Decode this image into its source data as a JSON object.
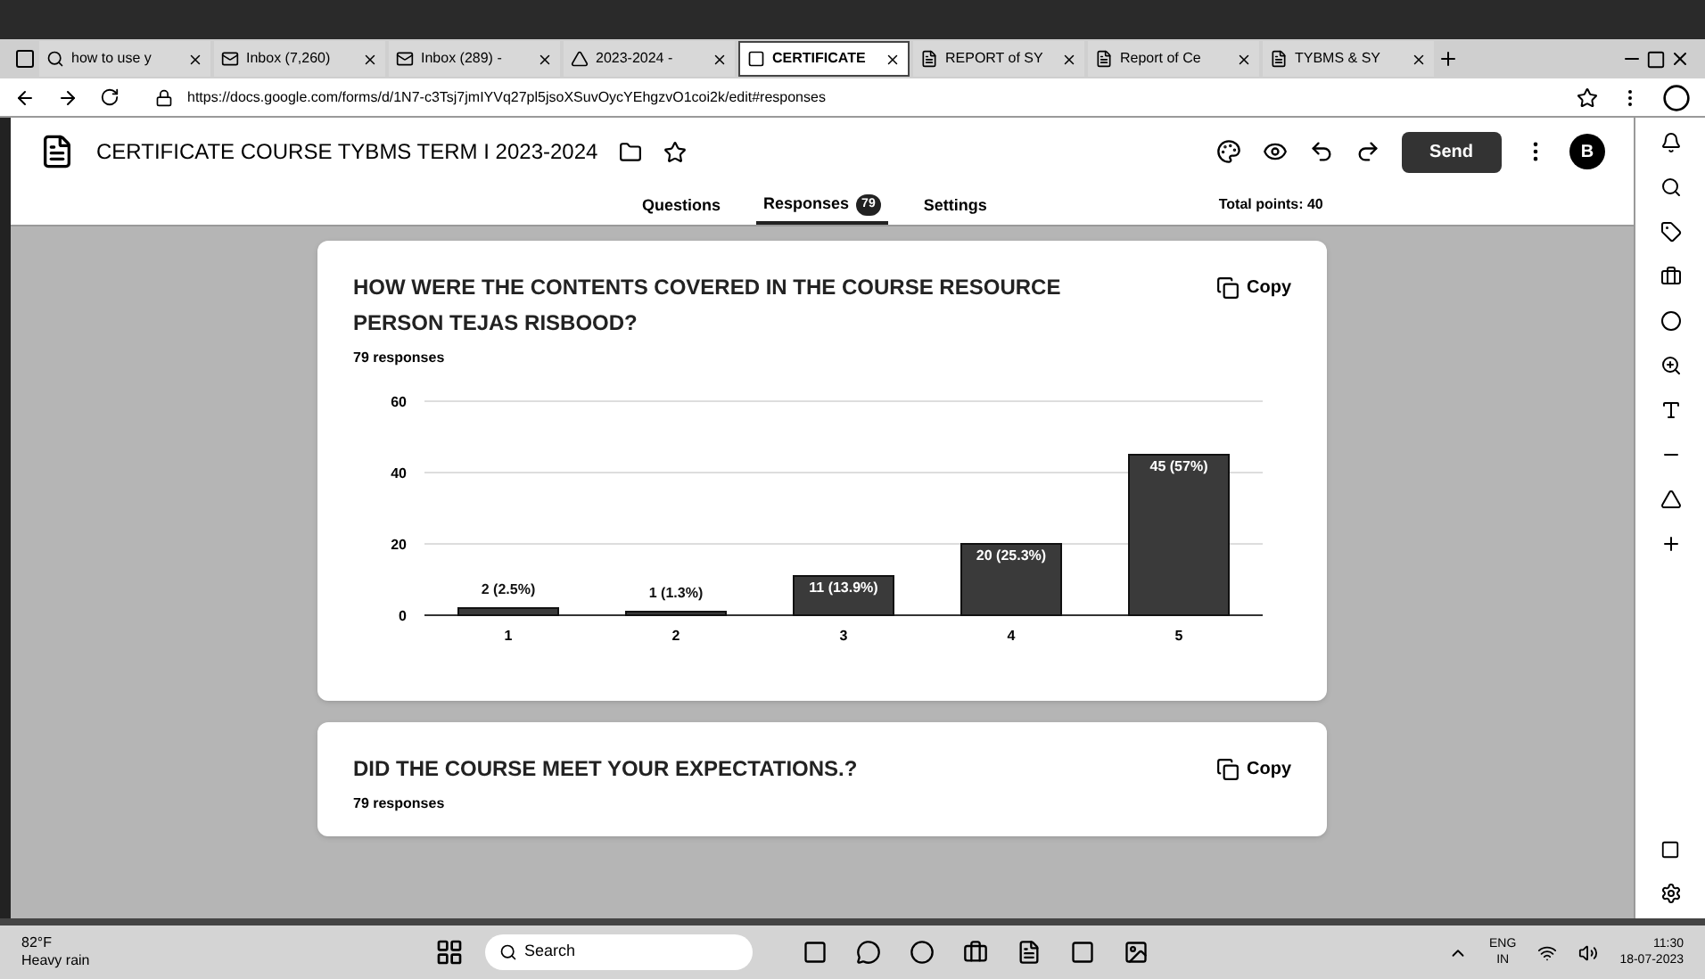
{
  "browser": {
    "tabs": [
      {
        "label": "how to use y",
        "selected": false
      },
      {
        "label": "Inbox (7,260)",
        "selected": false
      },
      {
        "label": "Inbox (289) -",
        "selected": false
      },
      {
        "label": "2023-2024 -",
        "selected": false
      },
      {
        "label": "CERTIFICATE",
        "selected": true
      },
      {
        "label": "REPORT of SY",
        "selected": false
      },
      {
        "label": "Report of Ce",
        "selected": false
      },
      {
        "label": "TYBMS & SY",
        "selected": false
      }
    ],
    "address": "https://docs.google.com/forms/d/1N7-c3Tsj7jmIYVq27pl5jsoXSuvOycYEhgzvO1coi2k/edit#responses"
  },
  "form": {
    "title": "CERTIFICATE COURSE TYBMS TERM I 2023-2024",
    "send": "Send",
    "avatar": "B",
    "tabs": [
      {
        "label": "Questions",
        "selected": false
      },
      {
        "label": "Responses",
        "selected": true,
        "badge": "79"
      },
      {
        "label": "Settings",
        "selected": false
      }
    ],
    "total_points": "Total points: 40"
  },
  "questions": [
    {
      "title": "HOW WERE THE CONTENTS COVERED IN THE COURSE RESOURCE PERSON TEJAS RISBOOD?",
      "copy": "Copy",
      "responses": "79 responses",
      "chart_data": {
        "type": "bar",
        "categories": [
          "1",
          "2",
          "3",
          "4",
          "5"
        ],
        "values": [
          2,
          1,
          11,
          20,
          45
        ],
        "ylim": [
          0,
          60
        ],
        "yticks": [
          0,
          20,
          40,
          60
        ],
        "value_labels": [
          "2 (2.5%)",
          "1 (1.3%)",
          "11 (13.9%)",
          "20 (25.3%)",
          "45 (57%)"
        ]
      }
    },
    {
      "title": "DID THE COURSE MEET YOUR EXPECTATIONS.?",
      "copy": "Copy",
      "responses": "79 responses"
    }
  ],
  "taskbar": {
    "weather_temp": "82°F",
    "weather_text": "Heavy rain",
    "search": "Search",
    "lang_top": "ENG",
    "lang_bottom": "IN",
    "time": "11:30",
    "date": "18-07-2023"
  }
}
